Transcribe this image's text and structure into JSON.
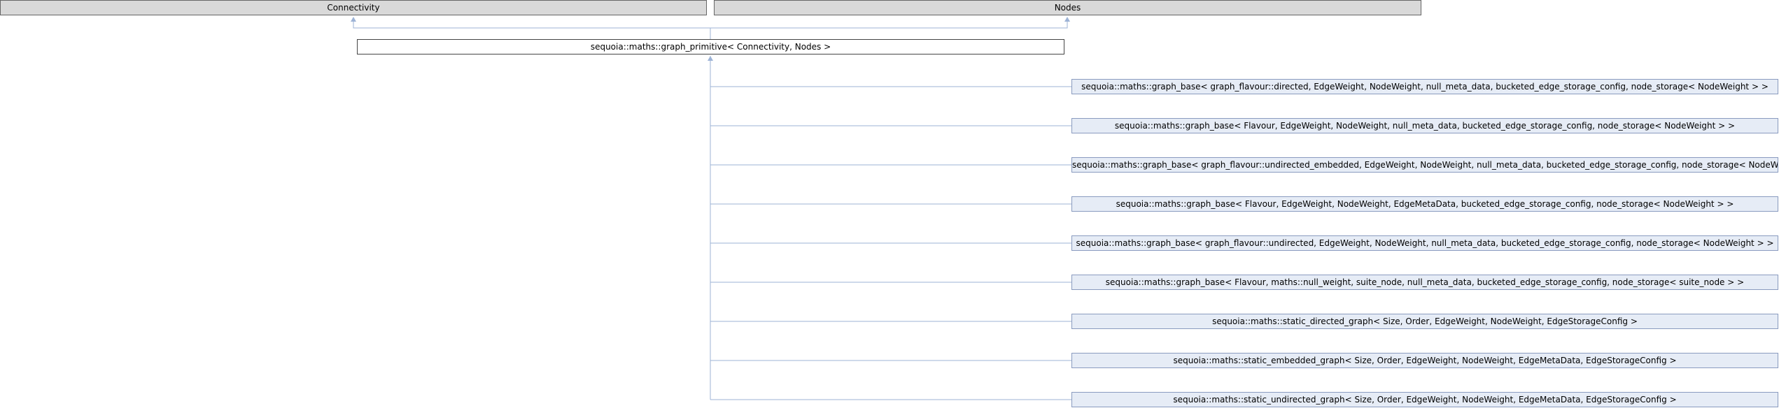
{
  "diagram": {
    "base_classes": [
      {
        "label": "Connectivity"
      },
      {
        "label": "Nodes"
      }
    ],
    "focus_class": {
      "label": "sequoia::maths::graph_primitive< Connectivity, Nodes >"
    },
    "derived_classes": [
      {
        "label": "sequoia::maths::graph_base< graph_flavour::directed, EdgeWeight, NodeWeight, null_meta_data, bucketed_edge_storage_config, node_storage< NodeWeight > >"
      },
      {
        "label": "sequoia::maths::graph_base< Flavour, EdgeWeight, NodeWeight, null_meta_data, bucketed_edge_storage_config, node_storage< NodeWeight > >"
      },
      {
        "label": "sequoia::maths::graph_base< graph_flavour::undirected_embedded, EdgeWeight, NodeWeight, null_meta_data, bucketed_edge_storage_config, node_storage< NodeWeight > >"
      },
      {
        "label": "sequoia::maths::graph_base< Flavour, EdgeWeight, NodeWeight, EdgeMetaData, bucketed_edge_storage_config, node_storage< NodeWeight > >"
      },
      {
        "label": "sequoia::maths::graph_base< graph_flavour::undirected, EdgeWeight, NodeWeight, null_meta_data, bucketed_edge_storage_config, node_storage< NodeWeight > >"
      },
      {
        "label": "sequoia::maths::graph_base< Flavour, maths::null_weight, suite_node, null_meta_data, bucketed_edge_storage_config, node_storage< suite_node > >"
      },
      {
        "label": "sequoia::maths::static_directed_graph< Size, Order, EdgeWeight, NodeWeight, EdgeStorageConfig >"
      },
      {
        "label": "sequoia::maths::static_embedded_graph< Size, Order, EdgeWeight, NodeWeight, EdgeMetaData, EdgeStorageConfig >"
      },
      {
        "label": "sequoia::maths::static_undirected_graph< Size, Order, EdgeWeight, NodeWeight, EdgeMetaData, EdgeStorageConfig >"
      }
    ],
    "colors": {
      "edge": "#9db3d6",
      "base_fill": "#d9d9d9",
      "derived_fill": "#e6ecf6"
    }
  }
}
